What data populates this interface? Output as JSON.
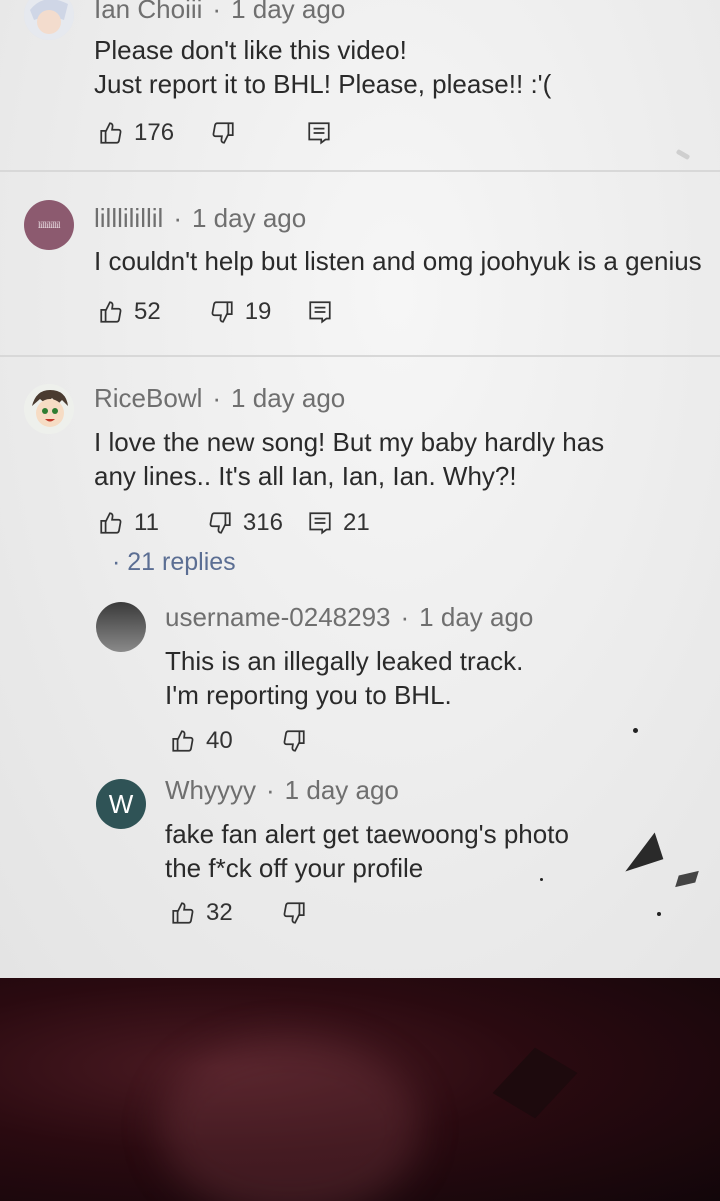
{
  "comments": [
    {
      "username": "Ian Choiii",
      "time": "1 day ago",
      "lines": [
        "Please don't like this video!",
        "Just report it to BHL! Please, please!! :'("
      ],
      "likes": "176",
      "dislikes": "",
      "reply_count": ""
    },
    {
      "username": "lilllilillil",
      "avatar_text": "lillilillil",
      "time": "1 day ago",
      "lines": [
        "I couldn't help but listen and omg joohyuk is a genius"
      ],
      "likes": "52",
      "dislikes": "19",
      "reply_count": ""
    },
    {
      "username": "RiceBowl",
      "time": "1 day ago",
      "lines": [
        "I love the new song! But my baby hardly has",
        "any lines.. It's all Ian, Ian, Ian. Why?!"
      ],
      "likes": "11",
      "dislikes": "316",
      "reply_count": "21",
      "replies_link": "21 replies"
    }
  ],
  "replies": [
    {
      "username": "username-0248293",
      "time": "1 day ago",
      "lines": [
        "This is an illegally leaked track.",
        "I'm reporting you to BHL."
      ],
      "likes": "40"
    },
    {
      "username": "Whyyyy",
      "avatar_letter": "W",
      "time": "1 day ago",
      "lines": [
        "fake fan alert get taewoong's photo",
        "the f*ck off your profile"
      ],
      "likes": "32"
    }
  ],
  "colors": {
    "avatar_purple": "#8c5a6f",
    "avatar_teal": "#2f5356",
    "reply_link": "#5b6e93"
  }
}
